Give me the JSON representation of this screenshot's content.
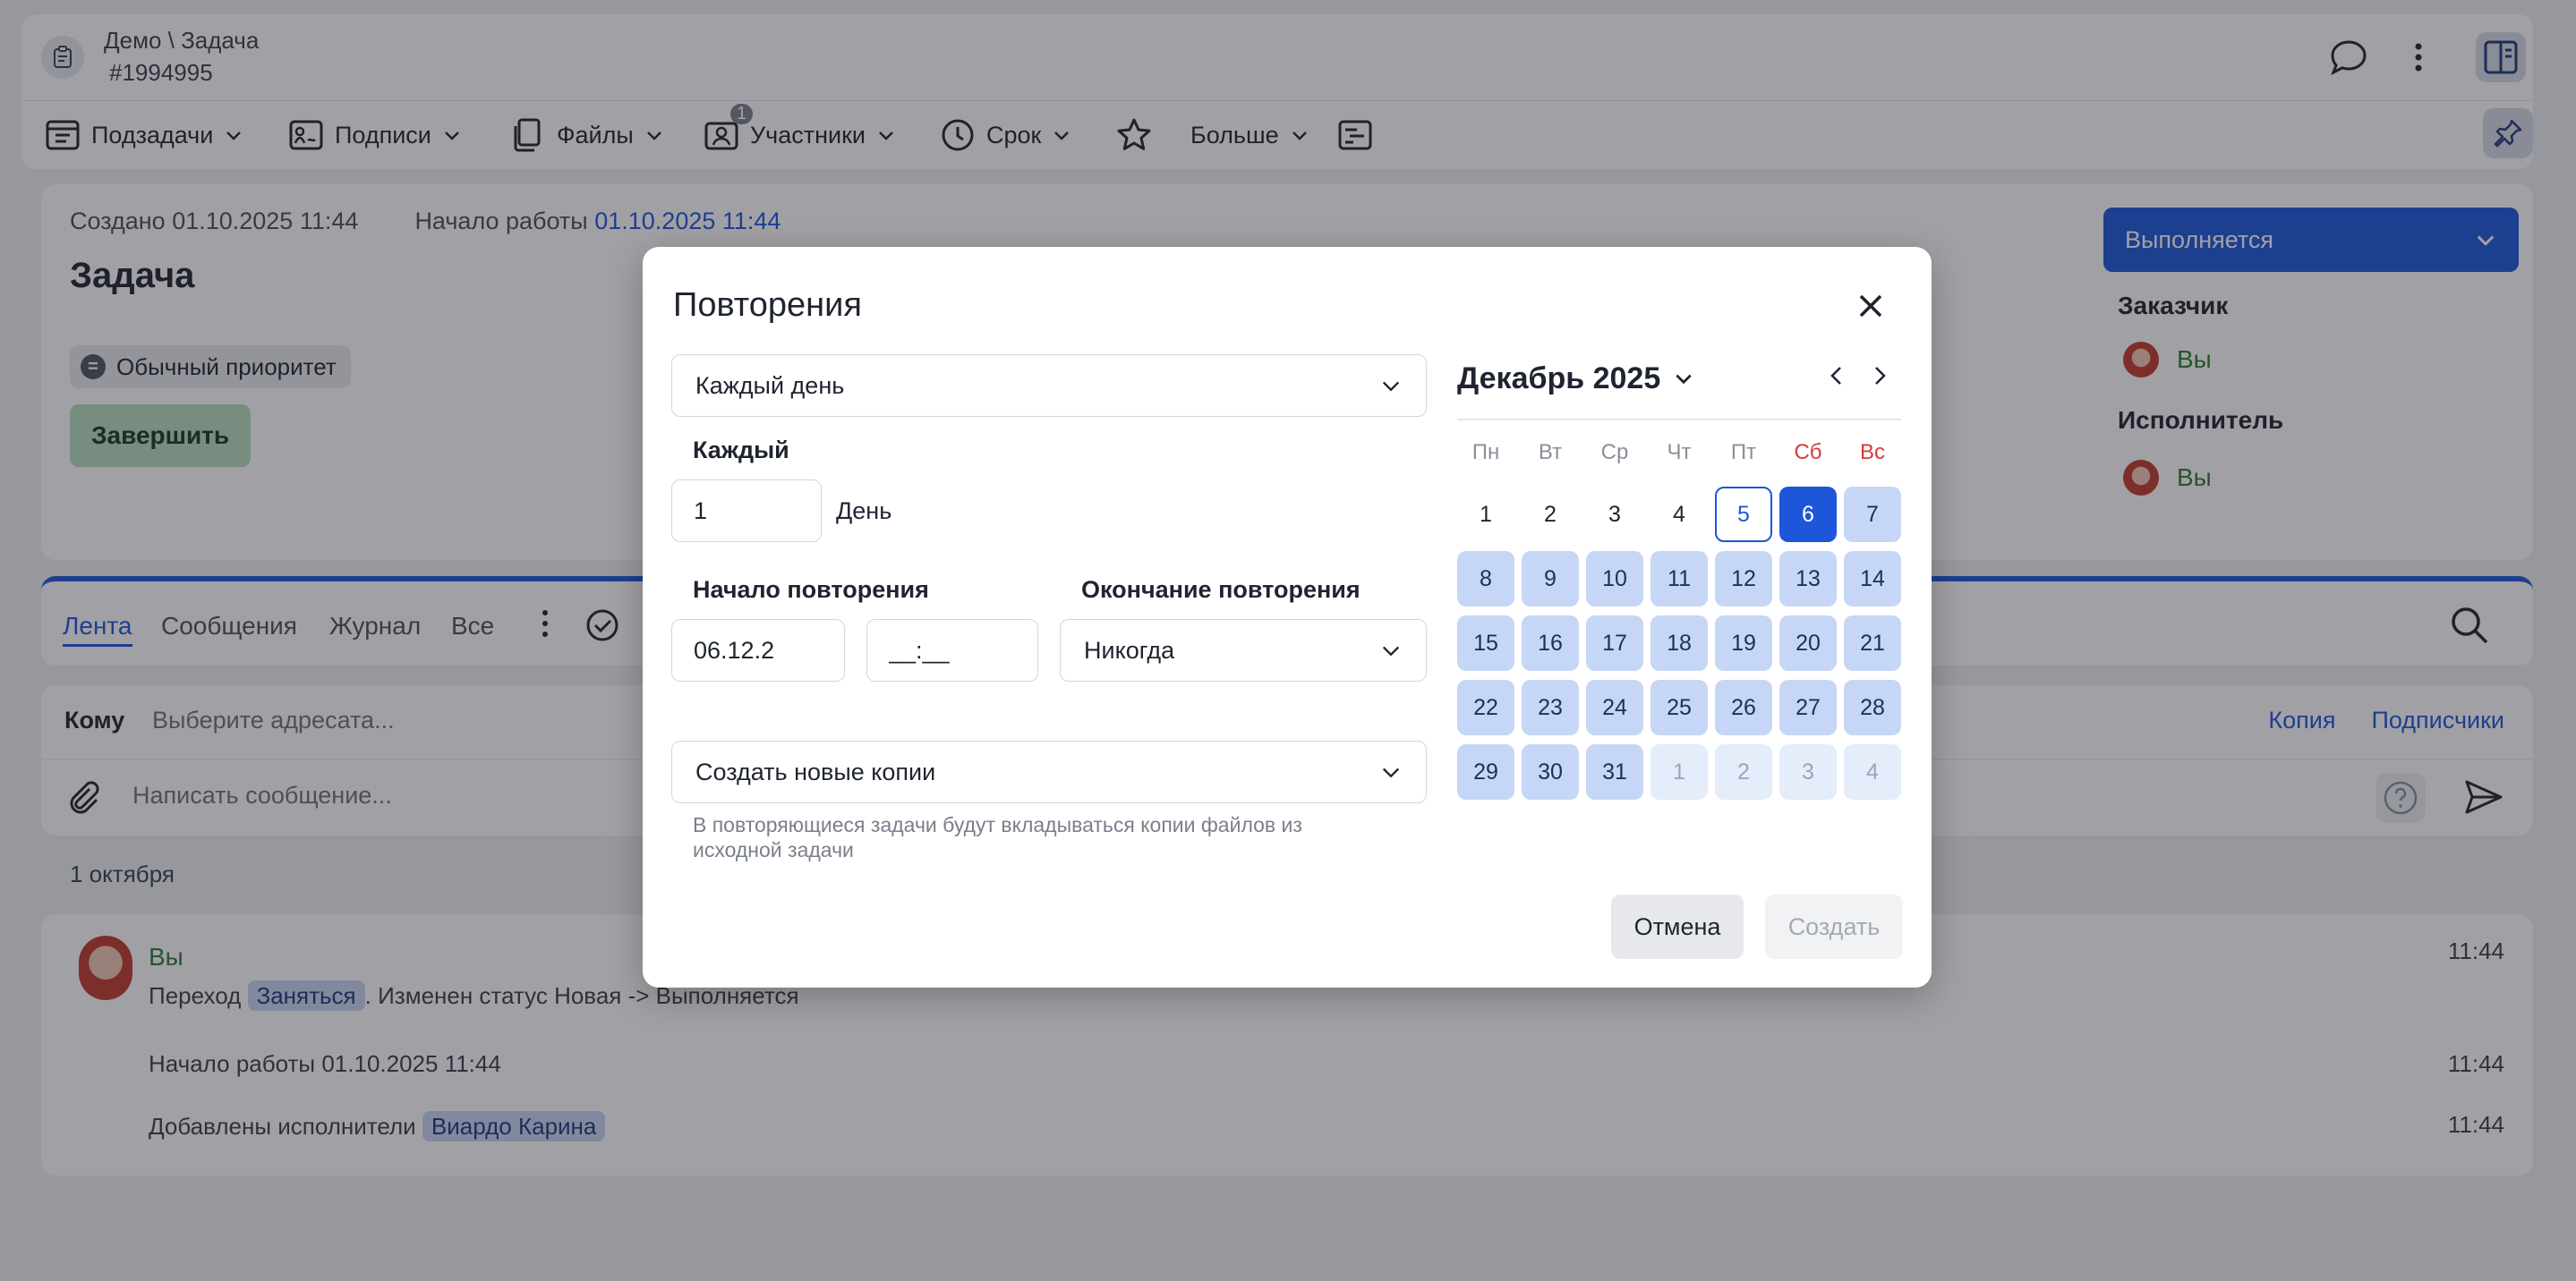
{
  "header": {
    "breadcrumb": "Демо \\ Задача",
    "task_id": "#1994995"
  },
  "toolbar": {
    "subtasks": "Подзадачи",
    "signatures": "Подписи",
    "files": "Файлы",
    "participants": "Участники",
    "participants_badge": "1",
    "deadline": "Срок",
    "more": "Больше"
  },
  "task": {
    "created_label": "Создано 01.10.2025 11:44",
    "start_label": "Начало работы",
    "start_value": "01.10.2025 11:44",
    "title": "Задача",
    "priority": "Обычный приоритет",
    "finish_button": "Завершить",
    "status": "Выполняется",
    "customer_heading": "Заказчик",
    "customer_name": "Вы",
    "assignee_heading": "Исполнитель",
    "assignee_name": "Вы"
  },
  "feed_tabs": [
    "Лента",
    "Сообщения",
    "Журнал",
    "Все"
  ],
  "composer": {
    "to_label": "Кому",
    "to_placeholder": "Выберите адресата...",
    "copy_link": "Копия",
    "subscribers_link": "Подписчики",
    "message_placeholder": "Написать сообщение..."
  },
  "feed": {
    "date": "1 октября",
    "author": "Вы",
    "entries": [
      {
        "pre": "Переход",
        "chip": "Заняться",
        "post": ". Изменен статус Новая -> Выполняется",
        "time": "11:44"
      },
      {
        "pre": "Начало работы 01.10.2025 11:44",
        "chip": "",
        "post": "",
        "time": "11:44"
      },
      {
        "pre": "Добавлены исполнители",
        "chip": "Виардо Карина",
        "post": "",
        "time": "11:44"
      }
    ]
  },
  "modal": {
    "title": "Повторения",
    "frequency": "Каждый день",
    "every_label": "Каждый",
    "every_value": "1",
    "every_unit": "День",
    "start_label": "Начало повторения",
    "start_date": "06.12.2",
    "start_time": "__:__",
    "end_label": "Окончание повторения",
    "end_value": "Никогда",
    "copies_option": "Создать новые копии",
    "hint": "В повторяющиеся задачи будут вкладываться копии файлов из исходной задачи",
    "cancel_button": "Отмена",
    "create_button": "Создать"
  },
  "calendar": {
    "month_label": "Декабрь 2025",
    "weekdays": [
      "Пн",
      "Вт",
      "Ср",
      "Чт",
      "Пт",
      "Сб",
      "Вс"
    ],
    "weeks": [
      [
        {
          "d": "1",
          "s": "plain"
        },
        {
          "d": "2",
          "s": "plain"
        },
        {
          "d": "3",
          "s": "plain"
        },
        {
          "d": "4",
          "s": "plain"
        },
        {
          "d": "5",
          "s": "today"
        },
        {
          "d": "6",
          "s": "sel"
        },
        {
          "d": "7",
          "s": "range"
        }
      ],
      [
        {
          "d": "8",
          "s": "range"
        },
        {
          "d": "9",
          "s": "range"
        },
        {
          "d": "10",
          "s": "range"
        },
        {
          "d": "11",
          "s": "range"
        },
        {
          "d": "12",
          "s": "range"
        },
        {
          "d": "13",
          "s": "range"
        },
        {
          "d": "14",
          "s": "range"
        }
      ],
      [
        {
          "d": "15",
          "s": "range"
        },
        {
          "d": "16",
          "s": "range"
        },
        {
          "d": "17",
          "s": "range"
        },
        {
          "d": "18",
          "s": "range"
        },
        {
          "d": "19",
          "s": "range"
        },
        {
          "d": "20",
          "s": "range"
        },
        {
          "d": "21",
          "s": "range"
        }
      ],
      [
        {
          "d": "22",
          "s": "range"
        },
        {
          "d": "23",
          "s": "range"
        },
        {
          "d": "24",
          "s": "range"
        },
        {
          "d": "25",
          "s": "range"
        },
        {
          "d": "26",
          "s": "range"
        },
        {
          "d": "27",
          "s": "range"
        },
        {
          "d": "28",
          "s": "range"
        }
      ],
      [
        {
          "d": "29",
          "s": "range"
        },
        {
          "d": "30",
          "s": "range"
        },
        {
          "d": "31",
          "s": "range"
        },
        {
          "d": "1",
          "s": "other"
        },
        {
          "d": "2",
          "s": "other"
        },
        {
          "d": "3",
          "s": "other"
        },
        {
          "d": "4",
          "s": "other"
        }
      ]
    ]
  },
  "colors": {
    "accent": "#1d56d9",
    "weekend": "#d33c3c",
    "range": "#c6d6f6",
    "user_name": "#2e7d32"
  }
}
